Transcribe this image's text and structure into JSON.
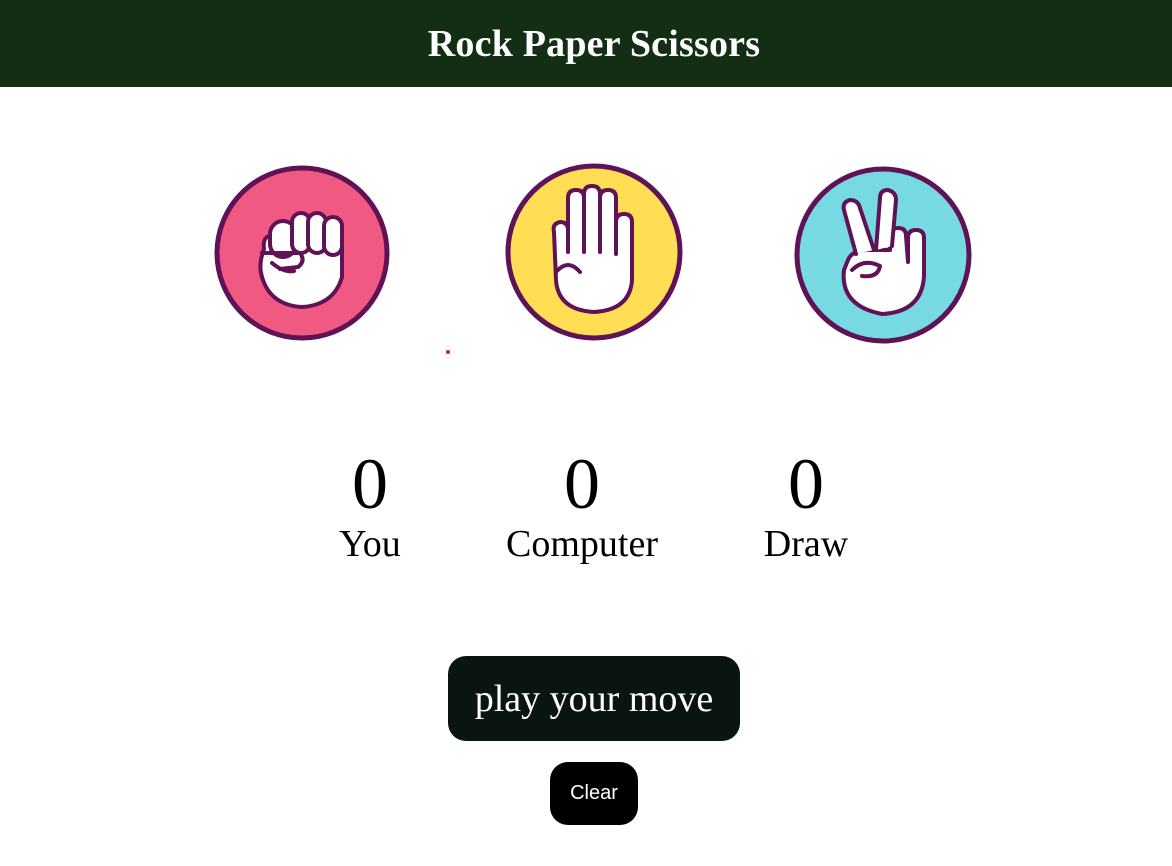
{
  "header": {
    "title": "Rock Paper Scissors",
    "background": "#142d15"
  },
  "choices": [
    {
      "id": "rock",
      "icon": "rock-fist-icon",
      "color": "#f05a82"
    },
    {
      "id": "paper",
      "icon": "paper-hand-icon",
      "color": "#ffdd55"
    },
    {
      "id": "scissors",
      "icon": "scissors-hand-icon",
      "color": "#77d9e1"
    }
  ],
  "outline_color": "#5f1256",
  "scores": {
    "you": {
      "value": "0",
      "label": "You"
    },
    "computer": {
      "value": "0",
      "label": "Computer"
    },
    "draw": {
      "value": "0",
      "label": "Draw"
    }
  },
  "buttons": {
    "play_label": "play your move",
    "clear_label": "Clear"
  }
}
